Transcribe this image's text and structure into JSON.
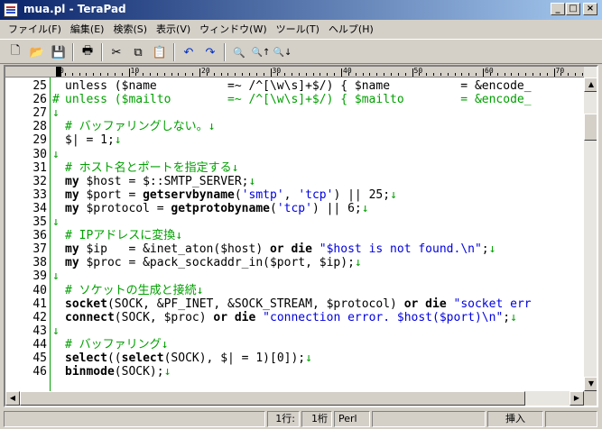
{
  "window": {
    "title": "mua.pl - TeraPad",
    "min": "_",
    "max": "□",
    "close": "×"
  },
  "menu": [
    "ファイル(F)",
    "編集(E)",
    "検索(S)",
    "表示(V)",
    "ウィンドウ(W)",
    "ツール(T)",
    "ヘルプ(H)"
  ],
  "toolbar": {
    "new": "🗋",
    "open": "📂",
    "save": "💾",
    "print": "🖶",
    "cut": "✂",
    "copy": "⧉",
    "paste": "📋",
    "undo": "↶",
    "redo": "↷",
    "find": "🔍",
    "find_next": "🔍↑",
    "find_prev": "🔍↓"
  },
  "ruler": {
    "labels": [
      "0",
      "10",
      "20",
      "30",
      "40",
      "50",
      "60",
      "70"
    ]
  },
  "editor": {
    "lines": [
      {
        "n": "25",
        "mark": "",
        "segs": [
          [
            "",
            "unless ($name          =~ /^[\\w\\s]+$/) { $name          = &encode_"
          ]
        ]
      },
      {
        "n": "26",
        "mark": "#",
        "segs": [
          [
            "cm",
            "unless ($mailto        =~ /^[\\w\\s]+$/) { $mailto        = &encode_"
          ]
        ]
      },
      {
        "n": "27",
        "mark": "↓",
        "segs": []
      },
      {
        "n": "28",
        "mark": "",
        "segs": [
          [
            "cm",
            "# バッファリングしない。"
          ],
          [
            "nl",
            "↓"
          ]
        ]
      },
      {
        "n": "29",
        "mark": "",
        "segs": [
          [
            "",
            "$| = 1;"
          ],
          [
            "nl",
            "↓"
          ]
        ]
      },
      {
        "n": "30",
        "mark": "↓",
        "segs": []
      },
      {
        "n": "31",
        "mark": "",
        "segs": [
          [
            "cm",
            "# ホスト名とポートを指定する"
          ],
          [
            "nl",
            "↓"
          ]
        ]
      },
      {
        "n": "32",
        "mark": "",
        "segs": [
          [
            "kw",
            "my"
          ],
          [
            "",
            " $host = $::SMTP_SERVER;"
          ],
          [
            "nl",
            "↓"
          ]
        ]
      },
      {
        "n": "33",
        "mark": "",
        "segs": [
          [
            "kw",
            "my"
          ],
          [
            "",
            " $port = "
          ],
          [
            "kw",
            "getservbyname"
          ],
          [
            "",
            "("
          ],
          [
            "str",
            "'smtp'"
          ],
          [
            "",
            ", "
          ],
          [
            "str",
            "'tcp'"
          ],
          [
            "",
            ") || 25;"
          ],
          [
            "nl",
            "↓"
          ]
        ]
      },
      {
        "n": "34",
        "mark": "",
        "segs": [
          [
            "kw",
            "my"
          ],
          [
            "",
            " $protocol = "
          ],
          [
            "kw",
            "getprotobyname"
          ],
          [
            "",
            "("
          ],
          [
            "str",
            "'tcp'"
          ],
          [
            "",
            ") || 6;"
          ],
          [
            "nl",
            "↓"
          ]
        ]
      },
      {
        "n": "35",
        "mark": "↓",
        "segs": []
      },
      {
        "n": "36",
        "mark": "",
        "segs": [
          [
            "cm",
            "# IPアドレスに変換"
          ],
          [
            "nl",
            "↓"
          ]
        ]
      },
      {
        "n": "37",
        "mark": "",
        "segs": [
          [
            "kw",
            "my"
          ],
          [
            "",
            " $ip   = &inet_aton($host) "
          ],
          [
            "kw",
            "or die"
          ],
          [
            "",
            " "
          ],
          [
            "str",
            "\"$host is not found.\\n\""
          ],
          [
            "",
            ";"
          ],
          [
            "nl",
            "↓"
          ]
        ]
      },
      {
        "n": "38",
        "mark": "",
        "segs": [
          [
            "kw",
            "my"
          ],
          [
            "",
            " $proc = &pack_sockaddr_in($port, $ip);"
          ],
          [
            "nl",
            "↓"
          ]
        ]
      },
      {
        "n": "39",
        "mark": "↓",
        "segs": []
      },
      {
        "n": "40",
        "mark": "",
        "segs": [
          [
            "cm",
            "# ソケットの生成と接続"
          ],
          [
            "nl",
            "↓"
          ]
        ]
      },
      {
        "n": "41",
        "mark": "",
        "segs": [
          [
            "kw",
            "socket"
          ],
          [
            "",
            "(SOCK, &PF_INET, &SOCK_STREAM, $protocol) "
          ],
          [
            "kw",
            "or die"
          ],
          [
            "",
            " "
          ],
          [
            "str",
            "\"socket err"
          ]
        ]
      },
      {
        "n": "42",
        "mark": "",
        "segs": [
          [
            "kw",
            "connect"
          ],
          [
            "",
            "(SOCK, $proc) "
          ],
          [
            "kw",
            "or die"
          ],
          [
            "",
            " "
          ],
          [
            "str",
            "\"connection error. $host($port)\\n\""
          ],
          [
            "",
            ";"
          ],
          [
            "nl",
            "↓"
          ]
        ]
      },
      {
        "n": "43",
        "mark": "↓",
        "segs": []
      },
      {
        "n": "44",
        "mark": "",
        "segs": [
          [
            "cm",
            "# バッファリング"
          ],
          [
            "nl",
            "↓"
          ]
        ]
      },
      {
        "n": "45",
        "mark": "",
        "segs": [
          [
            "kw",
            "select"
          ],
          [
            "",
            "(("
          ],
          [
            "kw",
            "select"
          ],
          [
            "",
            "(SOCK), $| = 1)[0]);"
          ],
          [
            "nl",
            "↓"
          ]
        ]
      },
      {
        "n": "46",
        "mark": "",
        "segs": [
          [
            "kw",
            "binmode"
          ],
          [
            "",
            "(SOCK);"
          ],
          [
            "nl",
            "↓"
          ]
        ]
      }
    ]
  },
  "status": {
    "row": "1行:",
    "col": "1桁",
    "mode": "Perl",
    "insert": "挿入"
  }
}
